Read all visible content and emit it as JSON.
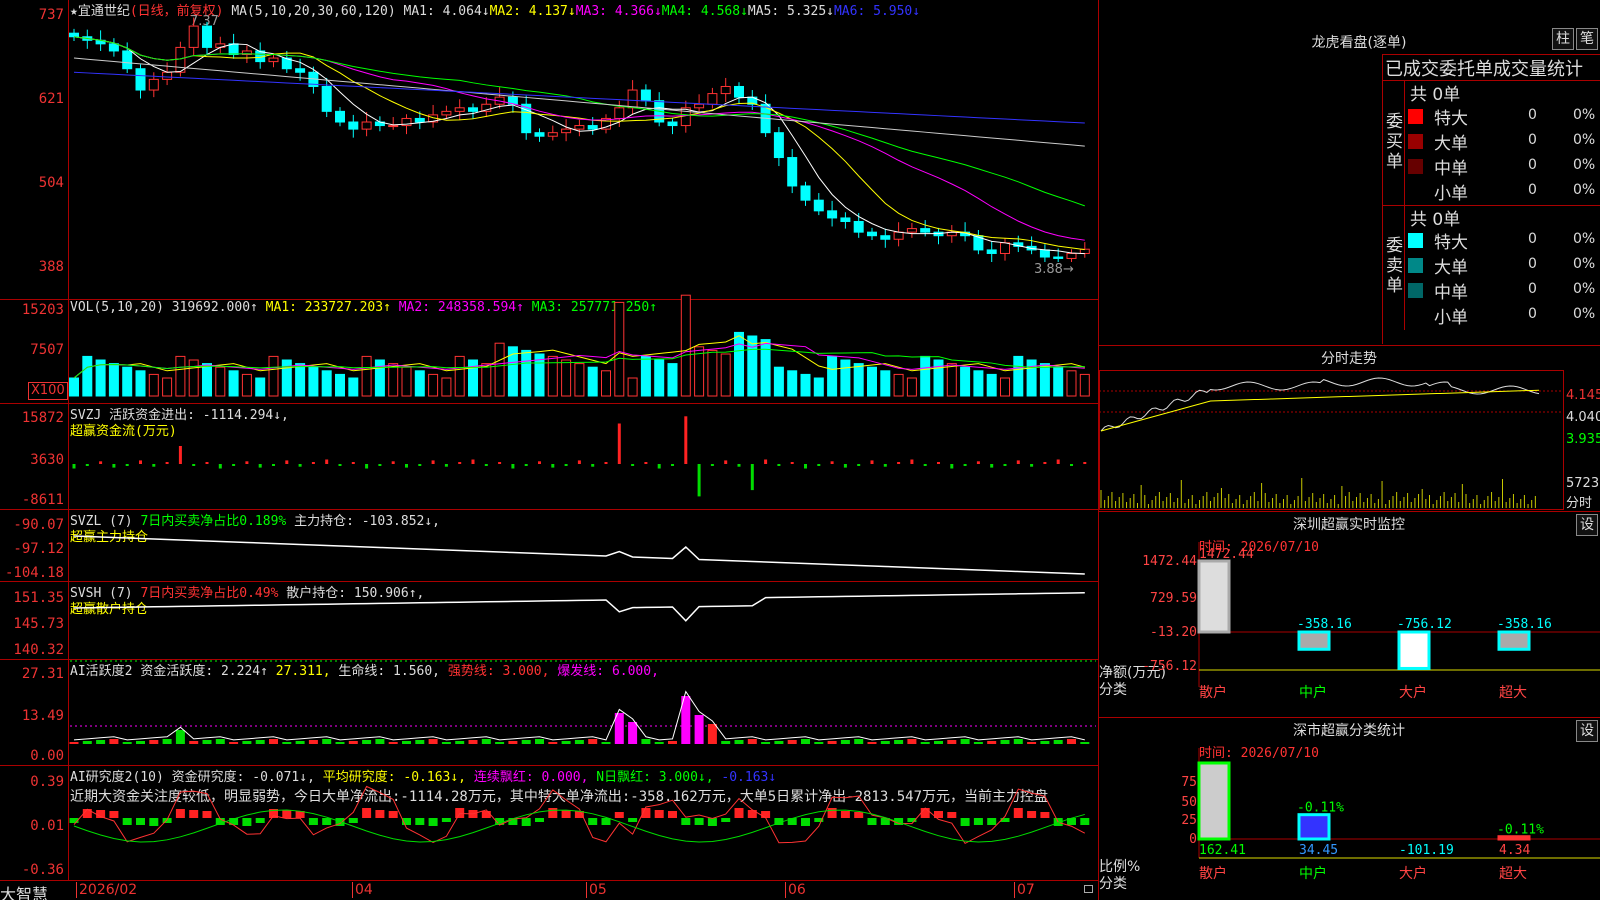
{
  "app": {
    "name": "大智慧"
  },
  "stock": {
    "name": "★宜通世纪",
    "period": "(日线，前复权)",
    "high_mark": "7.37",
    "low_mark": "3.88→"
  },
  "ma_header": {
    "params": "MA(5,10,20,30,60,120)",
    "items": [
      {
        "label": "MA1: 4.064↓",
        "color": "#ffffff"
      },
      {
        "label": "MA2: 4.137↓",
        "color": "#ffff00"
      },
      {
        "label": "MA3: 4.366↓",
        "color": "#ff00ff"
      },
      {
        "label": "MA4: 4.568↓",
        "color": "#00ff00"
      },
      {
        "label": "MA5: 5.325↓",
        "color": "#dddddd"
      },
      {
        "label": "MA6: 5.950↓",
        "color": "#3333ff"
      }
    ]
  },
  "price_axis": [
    "737",
    "621",
    "504",
    "388"
  ],
  "vol_header": {
    "params": "VOL(5,10,20)",
    "v": "319692.000↑",
    "ma1": "MA1: 233727.203↑",
    "ma2": "MA2: 248358.594↑",
    "ma3": "MA3: 257771.250↑"
  },
  "vol_axis": [
    "15203",
    "7507"
  ],
  "vol_unit": "X100",
  "svzj": {
    "title": "SVZJ  活跃资金进出: -1114.294↓,",
    "sub": "超赢资金流(万元)",
    "axis": [
      "15872",
      "3630",
      "-8611"
    ]
  },
  "svzl": {
    "name": "SVZL (7)",
    "pct": "7日内买卖净占比0.189%",
    "hold": "主力持仓: -103.852↓,",
    "sub": "超赢主力持仓",
    "axis": [
      "-90.07",
      "-97.12",
      "-104.18"
    ]
  },
  "svsh": {
    "name": "SVSH (7)",
    "pct": "7日内买卖净占比0.49%",
    "hold": "散户持仓: 150.906↑,",
    "sub": "超赢散户持仓",
    "axis": [
      "151.35",
      "145.73",
      "140.32"
    ]
  },
  "ai_active": {
    "name": "AI活跃度2",
    "a": "资金活跃度: 2.224↑",
    "b": "27.311,",
    "c": "生命线: 1.560,",
    "d": "强势线: 3.000,",
    "e": "爆发线: 6.000,",
    "axis": [
      "27.31",
      "13.49",
      "0.00"
    ]
  },
  "ai_research": {
    "name": "AI研究度2(10)",
    "a": "资金研究度: -0.071↓,",
    "b": "平均研究度: -0.163↓,",
    "c": "连续飘红: 0.000,",
    "d": "N日飘红: 3.000↓,",
    "e": "-0.163↓",
    "axis": [
      "0.39",
      "0.01",
      "-0.36"
    ],
    "comment": "近期大资金关注度较低，明显弱势，今日大单净流出:-1114.28万元，其中特大单净流出:-358.162万元，大单5日累计净出-2813.547万元，当前主力控盘"
  },
  "date_axis": [
    "2026/02",
    "04",
    "05",
    "06",
    "07"
  ],
  "lhb": {
    "title": "龙虎看盘(逐单)",
    "btn1": "柱",
    "btn2": "笔",
    "subtitle": "已成交委托单成交量统计",
    "buy_label": "委买单",
    "sell_label": "委卖单",
    "buy_total": "共 0单",
    "sell_total": "共 0单",
    "buy_rows": [
      {
        "name": "特大",
        "n": "0",
        "p": "0%",
        "color": "#ff0000"
      },
      {
        "name": "大单",
        "n": "0",
        "p": "0%",
        "color": "#990000"
      },
      {
        "name": "中单",
        "n": "0",
        "p": "0%",
        "color": "#660000"
      },
      {
        "name": "小单",
        "n": "0",
        "p": "0%",
        "color": ""
      }
    ],
    "sell_rows": [
      {
        "name": "特大",
        "n": "0",
        "p": "0%",
        "color": "#00ffff"
      },
      {
        "name": "大单",
        "n": "0",
        "p": "0%",
        "color": "#008888"
      },
      {
        "name": "中单",
        "n": "0",
        "p": "0%",
        "color": "#006666"
      },
      {
        "name": "小单",
        "n": "0",
        "p": "0%",
        "color": ""
      }
    ]
  },
  "fenshi": {
    "title": "分时走势",
    "axis": [
      "4.145",
      "4.040",
      "3.935"
    ],
    "vol": "5723",
    "vol_label": "分时"
  },
  "monitor": {
    "title": "深圳超赢实时监控",
    "btn": "设",
    "time": "时间: 2026/07/10",
    "axis": [
      "1472.44",
      "729.59",
      "-13.20",
      "-756.12"
    ],
    "ylabel": "净额(万元)",
    "xlabel": "分类",
    "bars": [
      {
        "cat": "散户",
        "val": "1472.44",
        "num": 1472.44
      },
      {
        "cat": "中户",
        "val": "-358.16",
        "num": -358.16
      },
      {
        "cat": "大户",
        "val": "-756.12",
        "num": -756.12
      },
      {
        "cat": "超大",
        "val": "-358.16",
        "num": -358.16
      }
    ]
  },
  "classify": {
    "title": "深市超赢分类统计",
    "btn": "设",
    "time": "时间: 2026/07/10",
    "axis": [
      "75",
      "50",
      "25",
      "0"
    ],
    "ylabel": "比例%",
    "xlabel": "分类",
    "bars": [
      {
        "cat": "散户",
        "val": "162.41",
        "pct": "",
        "num": 100
      },
      {
        "cat": "中户",
        "val": "34.45",
        "pct": "-0.11%",
        "num": 32
      },
      {
        "cat": "大户",
        "val": "-101.19",
        "pct": "",
        "num": 0
      },
      {
        "cat": "超大",
        "val": "4.34",
        "pct": "-0.11%",
        "num": 3
      }
    ]
  },
  "chart_data": {
    "type": "candlestick",
    "ylim": [
      3.88,
      7.37
    ],
    "close": [
      7.05,
      7.0,
      6.95,
      6.85,
      6.6,
      6.3,
      6.45,
      6.55,
      6.9,
      7.2,
      6.9,
      6.95,
      6.8,
      6.85,
      6.7,
      6.75,
      6.6,
      6.55,
      6.35,
      6.0,
      5.85,
      5.75,
      5.85,
      5.8,
      5.8,
      5.9,
      5.85,
      5.95,
      6.0,
      6.05,
      6.0,
      6.1,
      6.2,
      6.1,
      5.7,
      5.65,
      5.7,
      5.75,
      5.8,
      5.75,
      5.9,
      6.05,
      6.3,
      6.15,
      5.85,
      5.8,
      6.05,
      6.1,
      6.25,
      6.35,
      6.2,
      6.1,
      5.7,
      5.35,
      4.95,
      4.75,
      4.6,
      4.5,
      4.45,
      4.3,
      4.25,
      4.2,
      4.3,
      4.35,
      4.3,
      4.25,
      4.3,
      4.25,
      4.05,
      4.0,
      4.15,
      4.1,
      4.05,
      3.95,
      3.93,
      4.0,
      4.06
    ]
  }
}
